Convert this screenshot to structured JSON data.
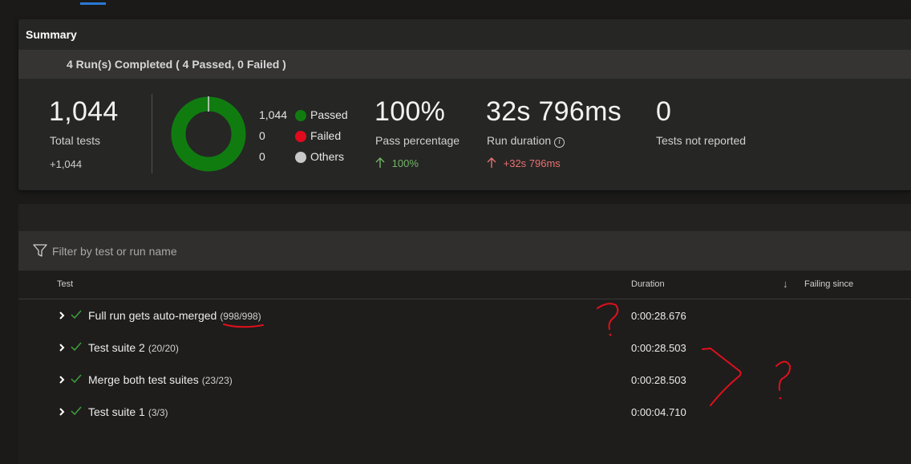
{
  "summary": {
    "title": "Summary",
    "runs_text": "4 Run(s) Completed ( 4 Passed, 0 Failed )",
    "total_tests": {
      "value": "1,044",
      "label": "Total tests",
      "delta": "+1,044"
    },
    "outcomes": {
      "passed": {
        "count": "1,044",
        "label": "Passed",
        "color": "#107c10"
      },
      "failed": {
        "count": "0",
        "label": "Failed",
        "color": "#e00b1c"
      },
      "others": {
        "count": "0",
        "label": "Others",
        "color": "#c8c8c8"
      }
    },
    "pass_percentage": {
      "value": "100%",
      "label": "Pass percentage",
      "delta": "100%"
    },
    "run_duration": {
      "value": "32s 796ms",
      "label": "Run duration",
      "delta": "+32s 796ms"
    },
    "not_reported": {
      "value": "0",
      "label": "Tests not reported"
    }
  },
  "filter": {
    "placeholder": "Filter by test or run name"
  },
  "table": {
    "columns": {
      "test": "Test",
      "duration": "Duration",
      "failing_since": "Failing since"
    },
    "rows": [
      {
        "name": "Full run gets auto-merged",
        "count": "(998/998)",
        "duration": "0:00:28.676"
      },
      {
        "name": "Test suite 2",
        "count": "(20/20)",
        "duration": "0:00:28.503"
      },
      {
        "name": "Merge both test suites",
        "count": "(23/23)",
        "duration": "0:00:28.503"
      },
      {
        "name": "Test suite 1",
        "count": "(3/3)",
        "duration": "0:00:04.710"
      }
    ]
  },
  "colors": {
    "accent": "#2b79d6",
    "pass_green": "#107c10",
    "delta_green": "#74b566",
    "delta_red": "#e8726f",
    "annotation_red": "#e0101c"
  },
  "icons": {
    "filter": "filter-funnel-icon",
    "expand": "chevron-right-icon",
    "status": "checkmark-icon",
    "sort": "arrow-down-icon",
    "info": "info-icon",
    "trend": "arrow-up-icon"
  }
}
